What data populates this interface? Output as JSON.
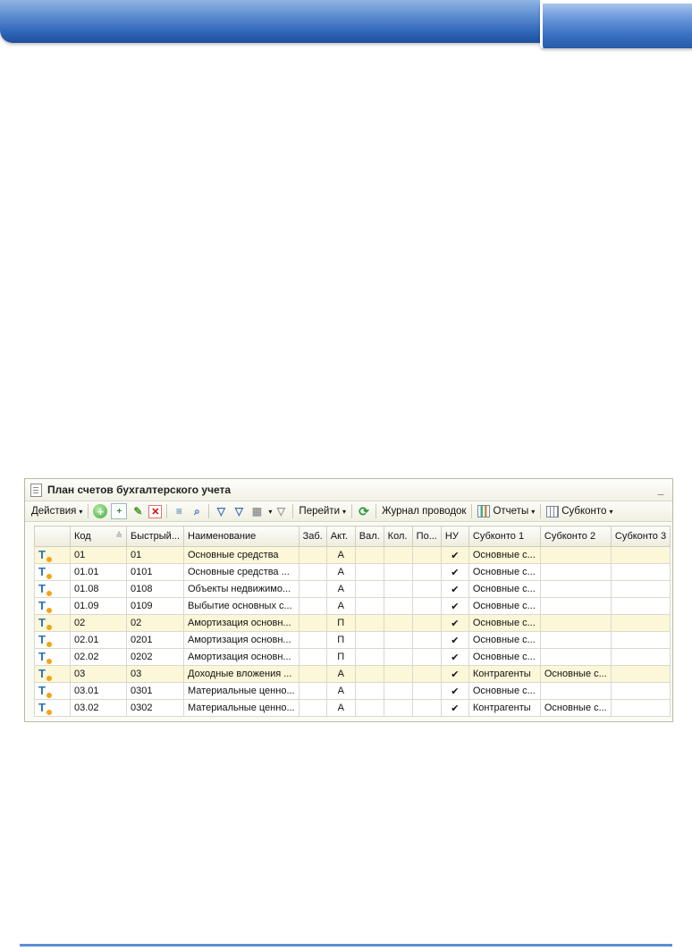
{
  "window": {
    "title": "План счетов бухгалтерского учета",
    "minimize_label": "_"
  },
  "toolbar": {
    "actions_label": "Действия",
    "goto_label": "Перейти",
    "journal_label": "Журнал проводок",
    "reports_label": "Отчеты",
    "subconto_label": "Субконто",
    "arrow": "▾"
  },
  "table": {
    "headers": [
      "",
      "Код",
      "Быстрый...",
      "Наименование",
      "Заб.",
      "Акт.",
      "Вал.",
      "Кол.",
      "По...",
      "НУ",
      "Субконто 1",
      "Субконто 2",
      "Субконто 3"
    ],
    "rows": [
      {
        "code": "01",
        "quick": "01",
        "name": "Основные средства",
        "act": "А",
        "nu": "✔",
        "sub1": "Основные с...",
        "sub2": "",
        "group": true
      },
      {
        "code": "01.01",
        "quick": "0101",
        "name": "Основные средства ...",
        "act": "А",
        "nu": "✔",
        "sub1": "Основные с...",
        "sub2": "",
        "group": false
      },
      {
        "code": "01.08",
        "quick": "0108",
        "name": "Объекты недвижимо...",
        "act": "А",
        "nu": "✔",
        "sub1": "Основные с...",
        "sub2": "",
        "group": false
      },
      {
        "code": "01.09",
        "quick": "0109",
        "name": "Выбытие основных с...",
        "act": "А",
        "nu": "✔",
        "sub1": "Основные с...",
        "sub2": "",
        "group": false
      },
      {
        "code": "02",
        "quick": "02",
        "name": "Амортизация основн...",
        "act": "П",
        "nu": "✔",
        "sub1": "Основные с...",
        "sub2": "",
        "group": true
      },
      {
        "code": "02.01",
        "quick": "0201",
        "name": "Амортизация основн...",
        "act": "П",
        "nu": "✔",
        "sub1": "Основные с...",
        "sub2": "",
        "group": false
      },
      {
        "code": "02.02",
        "quick": "0202",
        "name": "Амортизация основн...",
        "act": "П",
        "nu": "✔",
        "sub1": "Основные с...",
        "sub2": "",
        "group": false
      },
      {
        "code": "03",
        "quick": "03",
        "name": "Доходные вложения ...",
        "act": "А",
        "nu": "✔",
        "sub1": "Контрагенты",
        "sub2": "Основные с...",
        "group": true
      },
      {
        "code": "03.01",
        "quick": "0301",
        "name": "Материальные ценно...",
        "act": "А",
        "nu": "✔",
        "sub1": "Основные с...",
        "sub2": "",
        "group": false
      },
      {
        "code": "03.02",
        "quick": "0302",
        "name": "Материальные ценно...",
        "act": "А",
        "nu": "✔",
        "sub1": "Контрагенты",
        "sub2": "Основные с...",
        "group": false
      }
    ],
    "type_icon_glyph": "T"
  },
  "colors": {
    "header_blue": "#2f66b8",
    "group_row": "#fbf7d8",
    "icon_orange": "#f2a417"
  }
}
